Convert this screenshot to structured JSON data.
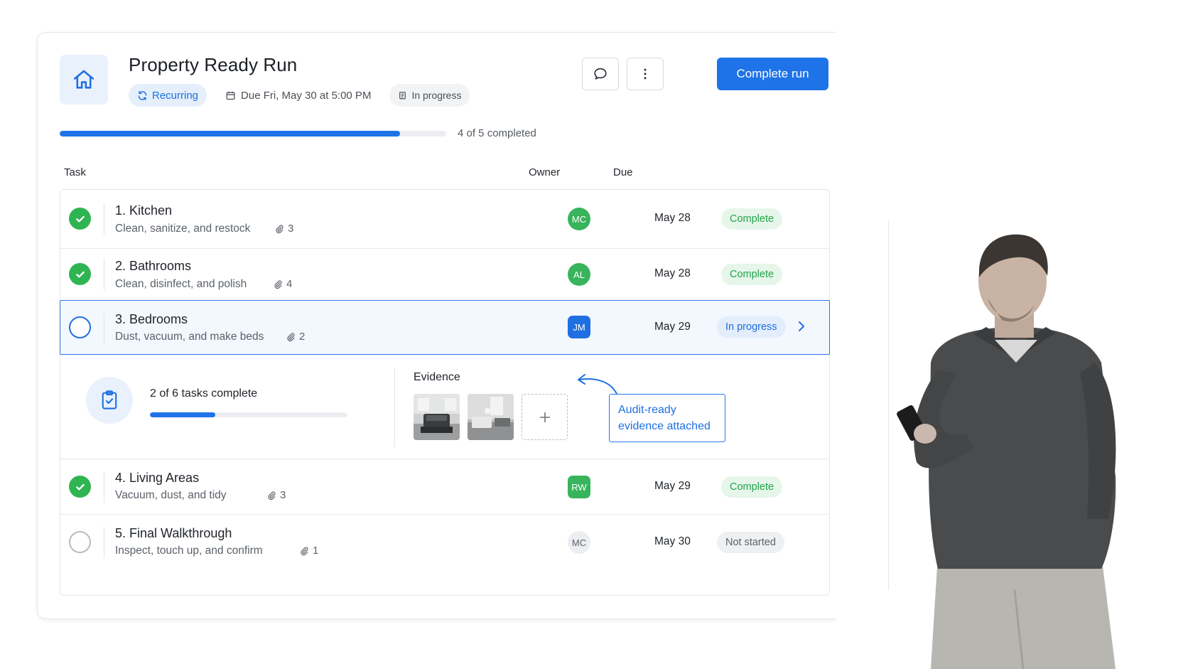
{
  "header": {
    "title": "Property Ready Run",
    "recurring_label": "Recurring",
    "due_label": "Due Fri, May 30 at 5:00 PM",
    "status_label": "In progress",
    "primary_button": "Complete run"
  },
  "progress": {
    "completed": 4,
    "total": 5,
    "fraction": 0.88,
    "label": "4 of 5 completed"
  },
  "columns": {
    "task": "Task",
    "owner": "Owner",
    "due": "Due"
  },
  "tasks": [
    {
      "name": "1. Kitchen",
      "subtitle": "Clean, sanitize, and restock",
      "attachments": "3",
      "owner": "MC",
      "owner_color": "#37b45c",
      "due": "May 28",
      "status": "Complete"
    },
    {
      "name": "2. Bathrooms",
      "subtitle": "Clean, disinfect, and polish",
      "attachments": "4",
      "owner": "AL",
      "owner_color": "#37b45c",
      "due": "May 28",
      "status": "Complete"
    },
    {
      "name": "3. Bedrooms",
      "subtitle": "Dust, vacuum, and make beds",
      "attachments": "2",
      "owner": "JM",
      "owner_color": "#1f6fe0",
      "due": "May 29",
      "status": "In progress"
    },
    {
      "name": "4. Living Areas",
      "subtitle": "Vacuum, dust, and tidy",
      "attachments": "3",
      "owner": "RW",
      "owner_color": "#37b45c",
      "due": "May 29",
      "status": "Complete"
    },
    {
      "name": "5. Final Walkthrough",
      "subtitle": "Inspect, touch up, and confirm",
      "attachments": "1",
      "owner": "MC",
      "owner_color": "#eceef1",
      "due": "May 30",
      "status": "Not started"
    }
  ],
  "expanded": {
    "subtasks_label": "2 of 6 tasks complete",
    "subtasks_fraction": 0.33,
    "evidence_label": "Evidence",
    "callout_line1": "Audit-ready",
    "callout_line2": "evidence attached"
  },
  "colors": {
    "accent": "#1f73e8",
    "success": "#2fb452"
  }
}
